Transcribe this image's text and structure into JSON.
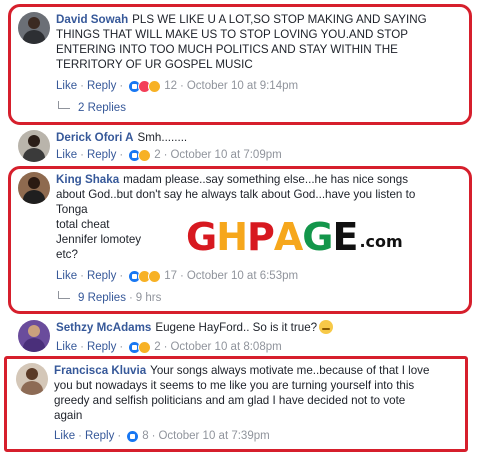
{
  "comments": [
    {
      "author": "David Sowah",
      "lines": [
        "PLS WE LIKE U A LOT,SO STOP MAKING AND SAYING",
        "THINGS THAT WILL MAKE US TO STOP LOVING YOU.AND STOP",
        "ENTERING INTO TOO MUCH POLITICS AND STAY WITHIN THE",
        "TERRITORY OF UR GOSPEL MUSIC"
      ],
      "like": "Like",
      "reply": "Reply",
      "reactions": [
        "like",
        "love",
        "haha"
      ],
      "reaction_count": "12",
      "time": "October 10 at 9:14pm",
      "replies": "2 Replies"
    },
    {
      "author": "Derick Ofori A",
      "lines": [
        "Smh........"
      ],
      "like": "Like",
      "reply": "Reply",
      "reactions": [
        "like",
        "haha"
      ],
      "reaction_count": "2",
      "time": "October 10 at 7:09pm"
    },
    {
      "author": "King Shaka",
      "lines": [
        "madam please..say something else...he has nice songs",
        "about God..but don't say he always talk about God...have you listen to",
        "Tonga",
        "total cheat",
        "Jennifer lomotey",
        "etc?"
      ],
      "like": "Like",
      "reply": "Reply",
      "reactions": [
        "like",
        "wow",
        "haha"
      ],
      "reaction_count": "17",
      "time": "October 10 at 6:53pm",
      "replies": "9 Replies",
      "replies_time": "9 hrs"
    },
    {
      "author": "Sethzy McAdams",
      "lines": [
        "Eugene HayFord.. So is it true?"
      ],
      "like": "Like",
      "reply": "Reply",
      "reactions": [
        "like",
        "haha"
      ],
      "reaction_count": "2",
      "time": "October 10 at 8:08pm"
    },
    {
      "author": "Francisca Kluvia",
      "lines": [
        "Your songs always motivate me..because of that I love",
        "you but nowadays it seems to me like you are turning yourself into this",
        "greedy and selfish politicians and am glad I have decided not to vote",
        "again"
      ],
      "like": "Like",
      "reply": "Reply",
      "reactions": [
        "like"
      ],
      "reaction_count": "8",
      "time": "October 10 at 7:39pm"
    }
  ],
  "watermark": {
    "g": "G",
    "h": "H",
    "space": " ",
    "p": "P",
    "a": "A",
    "g2": "G",
    "e": "E",
    "com": ".com"
  },
  "colors": {
    "highlight": "#d61f2c",
    "link": "#365899",
    "meta": "#90949c"
  }
}
